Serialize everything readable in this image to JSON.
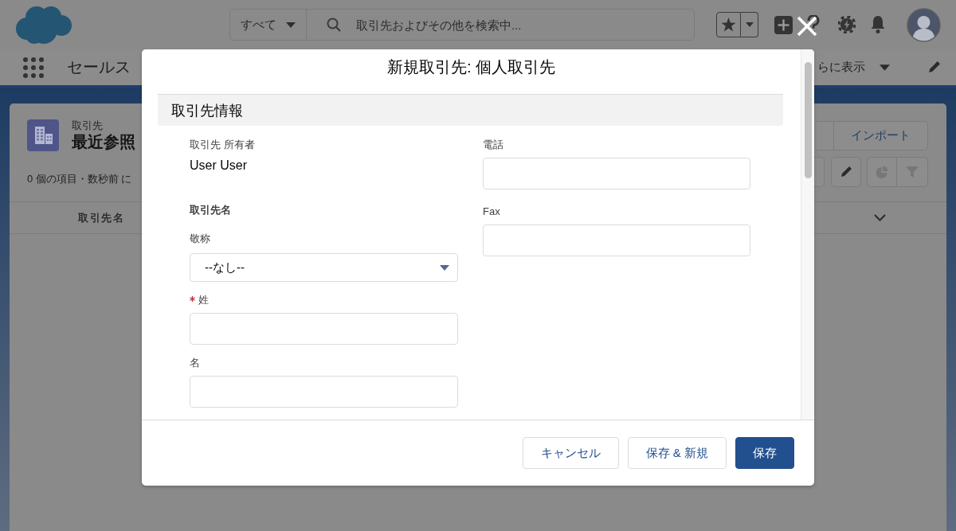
{
  "header": {
    "search": {
      "scope": "すべて",
      "placeholder": "取引先およびその他を検索中..."
    }
  },
  "nav": {
    "app_name": "セールス",
    "more_label": "らに表示"
  },
  "list_view": {
    "object_label": "取引先",
    "title": "最近参照",
    "status": "0 個の項目・数秒前 に",
    "action_buttons": [
      "インポート"
    ],
    "tool_buttons": [
      {
        "kind": "edit",
        "disabled": false
      },
      {
        "kind": "chart",
        "disabled": true
      },
      {
        "kind": "filter",
        "disabled": true
      }
    ],
    "columns": [
      "取引先名"
    ]
  },
  "modal": {
    "title": "新規取引先: 個人取引先",
    "section_title": "取引先情報",
    "columns": [
      {
        "fields": [
          {
            "kind": "readonly",
            "label": "取引先 所有者",
            "value": "User User"
          },
          {
            "kind": "group",
            "label": "取引先名"
          },
          {
            "kind": "select",
            "label": "敬称",
            "value": "--なし--"
          },
          {
            "kind": "text",
            "label": "姓",
            "required": true
          },
          {
            "kind": "text",
            "label": "名",
            "required": false
          }
        ]
      },
      {
        "fields": [
          {
            "kind": "text",
            "label": "電話",
            "required": false
          },
          {
            "kind": "text",
            "label": "Fax",
            "required": false
          }
        ]
      }
    ],
    "buttons": [
      {
        "label": "キャンセル",
        "kind": "neutral"
      },
      {
        "label": "保存 & 新規",
        "kind": "neutral"
      },
      {
        "label": "保存",
        "kind": "brand"
      }
    ]
  }
}
